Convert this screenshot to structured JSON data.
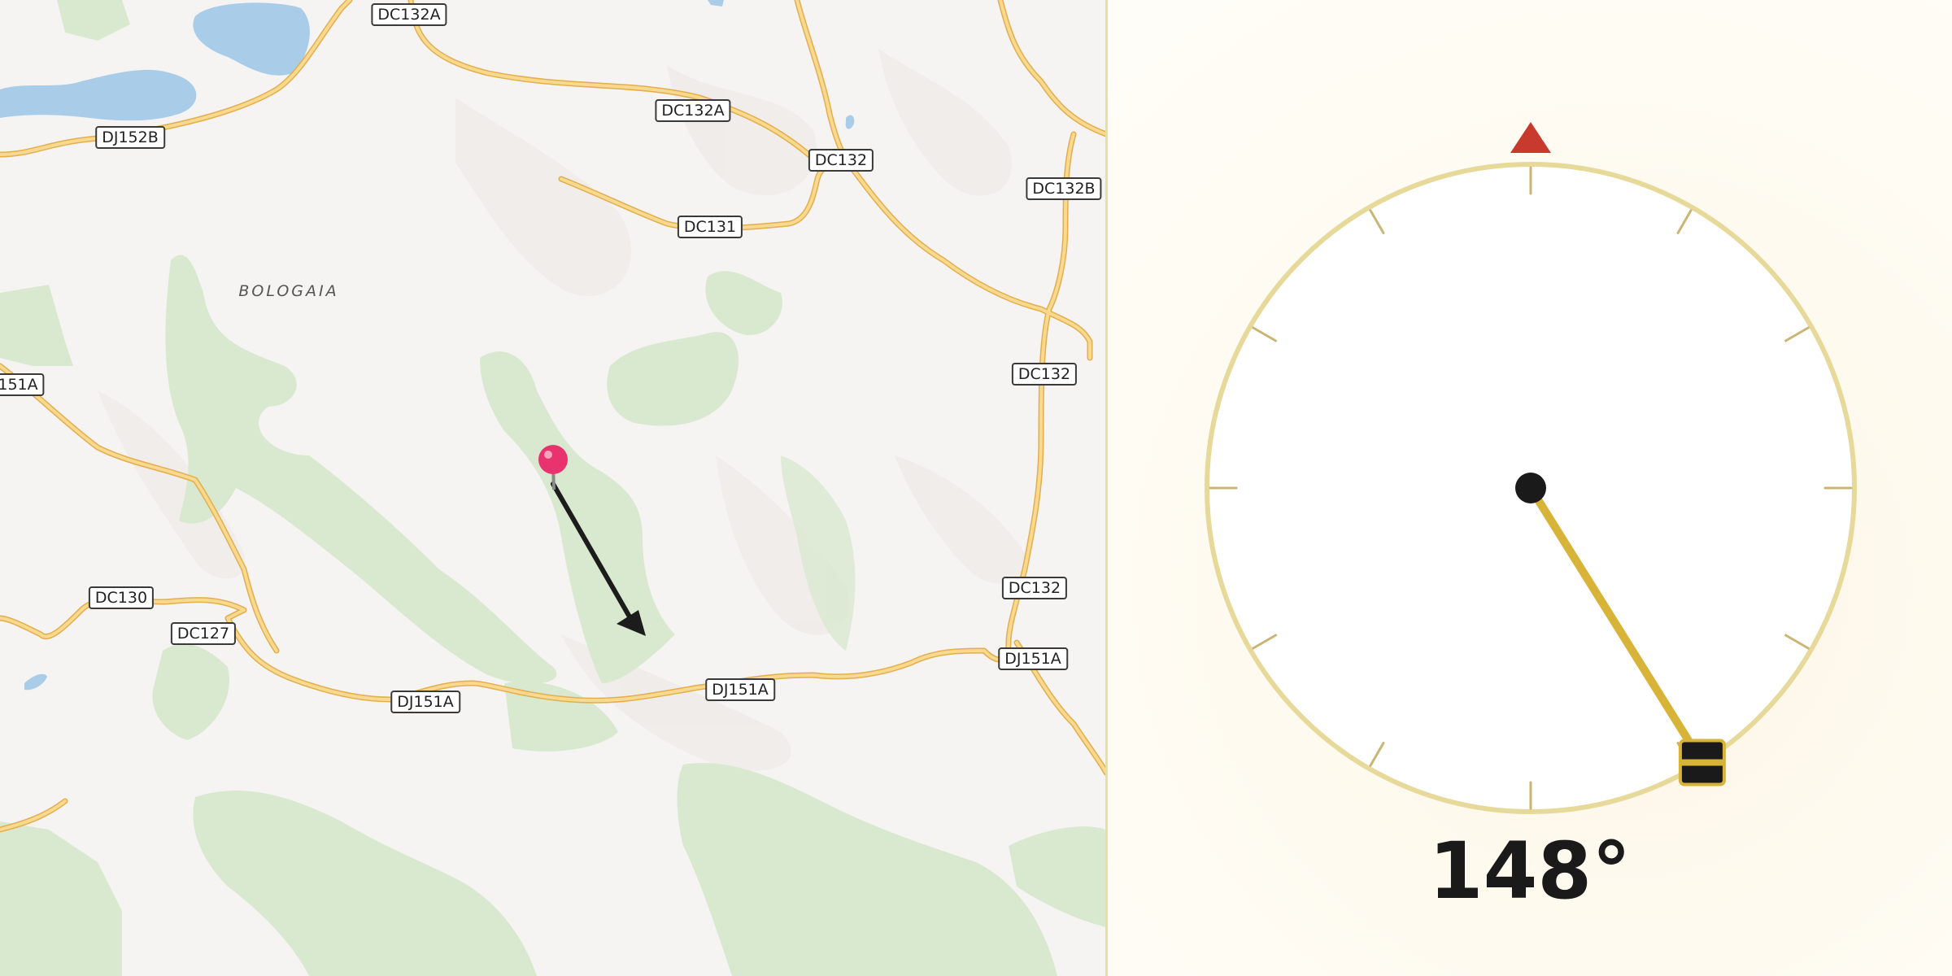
{
  "map": {
    "place_labels": [
      {
        "id": "bologaia",
        "text": "BOLOGAIA"
      }
    ],
    "road_labels": [
      {
        "id": "dc132a-top",
        "text": "DC132A"
      },
      {
        "id": "dc132a-mid",
        "text": "DC132A"
      },
      {
        "id": "dj152b",
        "text": "DJ152B"
      },
      {
        "id": "dc132-top",
        "text": "DC132"
      },
      {
        "id": "dc132b",
        "text": "DC132B"
      },
      {
        "id": "dc131",
        "text": "DC131"
      },
      {
        "id": "dj151a-left",
        "text": "151A"
      },
      {
        "id": "dc132-mid",
        "text": "DC132"
      },
      {
        "id": "dc132-low",
        "text": "DC132"
      },
      {
        "id": "dj151a-right",
        "text": "DJ151A"
      },
      {
        "id": "dc130",
        "text": "DC130"
      },
      {
        "id": "dc127",
        "text": "DC127"
      },
      {
        "id": "dj151a-center",
        "text": "DJ151A"
      },
      {
        "id": "dj151a-bottom",
        "text": "DJ151A"
      }
    ],
    "colors": {
      "road": "#f3c46a",
      "road_casing": "#e2ae4f",
      "forest": "#d9e9cf",
      "water": "#a9cde8",
      "pin": "#e8336f",
      "arrow": "#1c1c1c"
    }
  },
  "compass": {
    "heading_deg": 148,
    "heading_text": "148°",
    "north_marker_color": "#c93a2e",
    "ring_color": "#e6d99a",
    "needle_color": "#d7b338",
    "tick_color": "#c9b574"
  }
}
